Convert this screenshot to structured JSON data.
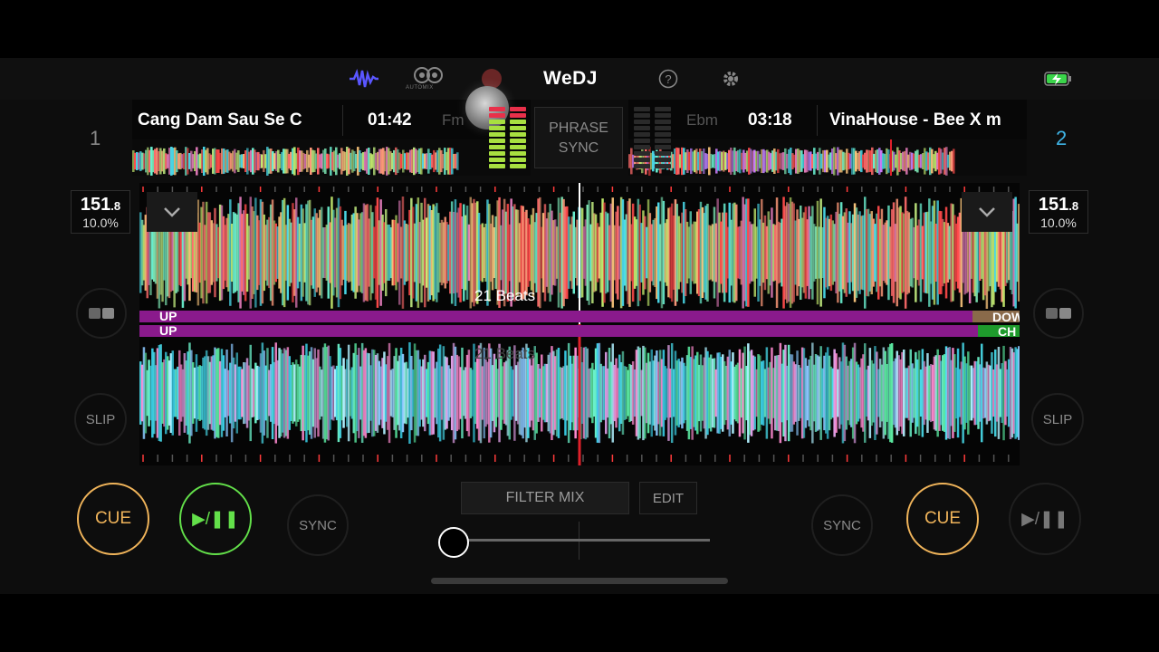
{
  "app": {
    "name": "WeDJ"
  },
  "topbar": {
    "automix_label": "AUTOMIX",
    "icons": [
      "waveform-icon",
      "automix-icon",
      "help-icon",
      "settings-icon",
      "battery-charging-icon"
    ]
  },
  "deck1": {
    "number": "1",
    "title": "Cang Dam Sau Se C",
    "time": "01:42",
    "key": "Fm",
    "bpm_int": "151",
    "bpm_dec": ".8",
    "pitch": "10.0%",
    "beats": "21 Beats",
    "phrase_start": "UP",
    "phrase_end": "DOW",
    "cue_label": "CUE",
    "play_label": "▶/❚❚",
    "sync_label": "SYNC",
    "slip_label": "SLIP"
  },
  "deck2": {
    "number": "2",
    "title": "VinaHouse - Bee X m",
    "time": "03:18",
    "key": "Ebm",
    "bpm_int": "151",
    "bpm_dec": ".8",
    "pitch": "10.0%",
    "beats": "21 Beats",
    "phrase_start": "UP",
    "phrase_end": "CH",
    "cue_label": "CUE",
    "play_label": "▶/❚❚",
    "sync_label": "SYNC",
    "slip_label": "SLIP"
  },
  "mixer": {
    "phrase_sync": "PHRASE\nSYNC",
    "filter_mix": "FILTER MIX",
    "edit": "EDIT",
    "crossfader_position": 0.0
  },
  "colors": {
    "cue": "#f0b45a",
    "play_active": "#63e04a",
    "deck2_number": "#3fb4e6",
    "phrase_bar": "#8a1a8c",
    "waveform_accent": "#ff3b3b"
  }
}
